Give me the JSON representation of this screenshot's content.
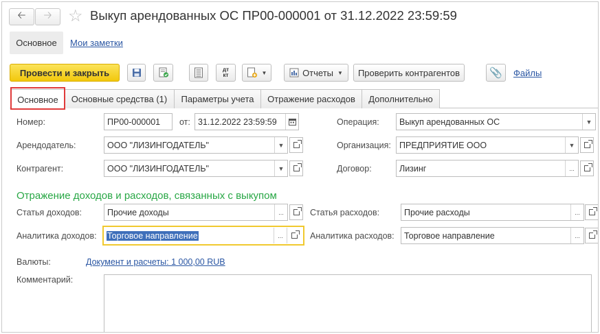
{
  "window": {
    "title": "Выкуп арендованных ОС ПР00-000001 от 31.12.2022 23:59:59",
    "back_icon": "arrow-left",
    "forward_icon": "arrow-right",
    "favorite_icon": "star"
  },
  "sections": {
    "active": "Основное",
    "notes_link": "Мои заметки"
  },
  "toolbar": {
    "post_close_label": "Провести и закрыть",
    "reports_label": "Отчеты",
    "check_counterparties_label": "Проверить контрагентов",
    "files_label": "Файлы",
    "dtkt_top": "дт",
    "dtkt_bottom": "кт"
  },
  "tabs": [
    {
      "label": "Основное"
    },
    {
      "label": "Основные средства (1)"
    },
    {
      "label": "Параметры учета"
    },
    {
      "label": "Отражение расходов"
    },
    {
      "label": "Дополнительно"
    }
  ],
  "form": {
    "number_label": "Номер:",
    "number_value": "ПР00-000001",
    "date_label": "от:",
    "date_value": "31.12.2022 23:59:59",
    "operation_label": "Операция:",
    "operation_value": "Выкуп арендованных ОС",
    "lessor_label": "Арендодатель:",
    "lessor_value": "ООО \"ЛИЗИНГОДАТЕЛЬ\"",
    "organization_label": "Организация:",
    "organization_value": "ПРЕДПРИЯТИЕ ООО",
    "counterparty_label": "Контрагент:",
    "counterparty_value": "ООО \"ЛИЗИНГОДАТЕЛЬ\"",
    "contract_label": "Договор:",
    "contract_value": "Лизинг",
    "section_title": "Отражение доходов и расходов, связанных с выкупом",
    "income_item_label": "Статья доходов:",
    "income_item_value": "Прочие доходы",
    "expense_item_label": "Статья расходов:",
    "expense_item_value": "Прочие расходы",
    "income_analytics_label": "Аналитика доходов:",
    "income_analytics_value": "Торговое направление",
    "expense_analytics_label": "Аналитика расходов:",
    "expense_analytics_value": "Торговое направление",
    "currency_label": "Валюты:",
    "currency_link": "Документ и расчеты: 1 000,00 RUB",
    "comment_label": "Комментарий:",
    "comment_value": ""
  },
  "colors": {
    "primary_button": "#f2c80c",
    "link": "#2a56a3",
    "section_title": "#28a745",
    "tab_highlight": "#e03a3a",
    "focus_border": "#f0c92e",
    "selection": "#3e6fba"
  }
}
